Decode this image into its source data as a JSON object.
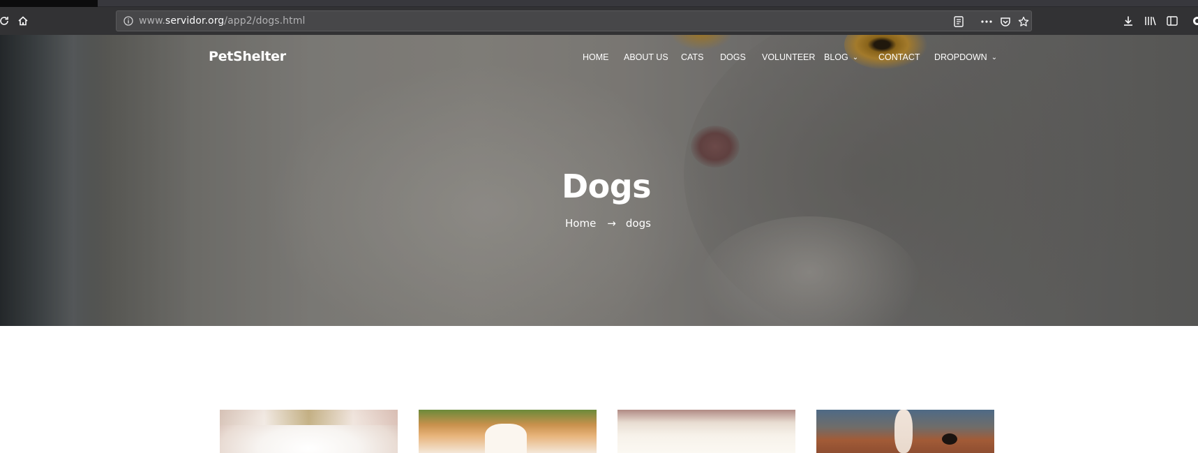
{
  "browser": {
    "url_prefix": "www.",
    "url_host": "servidor.org",
    "url_path": "/app2/dogs.html",
    "icons": {
      "reload": "reload-icon",
      "home": "home-icon",
      "info": "info-icon",
      "reader": "reader-mode-icon",
      "more": "more-actions-icon",
      "pocket": "pocket-icon",
      "bookmark": "bookmark-star-icon",
      "download": "download-icon",
      "library": "library-icon",
      "sidebar": "sidebar-icon"
    }
  },
  "site": {
    "logo": "PetShelter",
    "nav": [
      {
        "label": "HOME"
      },
      {
        "label": "ABOUT US"
      },
      {
        "label": "CATS"
      },
      {
        "label": "DOGS"
      },
      {
        "label": "VOLUNTEER"
      },
      {
        "label": "BLOG",
        "caret": "⌄"
      },
      {
        "label": "CONTACT"
      },
      {
        "label": "DROPDOWN",
        "caret": "⌄"
      }
    ]
  },
  "hero": {
    "title": "Dogs",
    "breadcrumb": {
      "home": "Home",
      "arrow": "→",
      "current": "dogs"
    }
  },
  "thumbnails": [
    {
      "name": "dog-thumbnail-1"
    },
    {
      "name": "dog-thumbnail-2"
    },
    {
      "name": "dog-thumbnail-3"
    },
    {
      "name": "dog-thumbnail-4"
    }
  ],
  "colors": {
    "toolbar": "#323234",
    "urlbar": "#474749",
    "hero_text": "#ffffff",
    "page_background": "#ffffff"
  }
}
